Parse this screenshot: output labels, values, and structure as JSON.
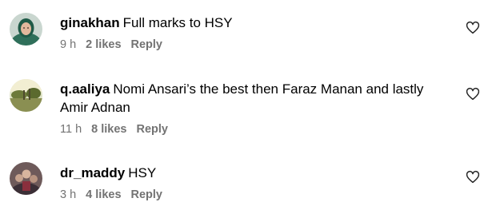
{
  "comments": [
    {
      "username": "ginakhan",
      "text": "Full marks to HSY",
      "time": "9 h",
      "likes": "2 likes",
      "reply": "Reply",
      "avatar_icon": "avatar-woman-headscarf-icon"
    },
    {
      "username": "q.aaliya",
      "text": "Nomi Ansari’s the best then Faraz Manan and lastly Amir Adnan",
      "time": "11 h",
      "likes": "8 likes",
      "reply": "Reply",
      "avatar_icon": "avatar-landscape-icon"
    },
    {
      "username": "dr_maddy",
      "text": "HSY",
      "time": "3 h",
      "likes": "4 likes",
      "reply": "Reply",
      "avatar_icon": "avatar-group-photo-icon"
    }
  ],
  "icons": {
    "like": "heart-outline-icon"
  },
  "colors": {
    "text": "#000000",
    "meta": "#737373",
    "background": "#ffffff"
  }
}
